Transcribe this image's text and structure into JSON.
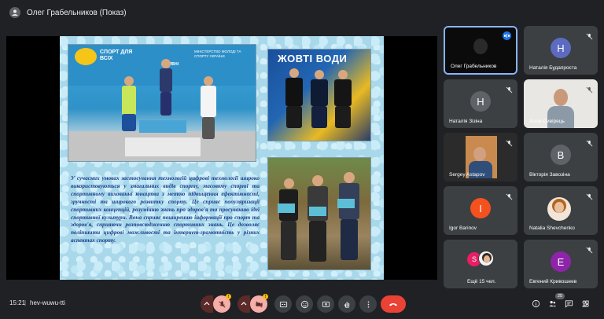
{
  "header": {
    "title": "Олег Грабельников (Показ)"
  },
  "slide": {
    "photo1_banner_left": "СПОРТ ДЛЯ ВСІХ",
    "photo1_banner_mid": "АКТИВНІ",
    "photo1_banner_right": "МІНІСТЕРСТВО МОЛОДІ ТА СПОРТУ УКРАЇНИ",
    "photo2_banner": "ЖОВТІ ВОДИ",
    "text": "У сучасних умовах застосування технологій цифрові технології широко використовуються у змагальних видів спорту, масовому спорті та спортивному вихованні юнацтва з метою підвищення ефективності, зручності та широкого розвитку спорту. Це сприяє популяризації спортивних концепцій, розумінню знань про здоров'я та просуванню ідеї спортивної культури. Вона сприяє поширенню інформації про спорт та здоров'я, сприяючи розповсюдженню спортивних знань. Це дозволяє поліпшити цифрові можливості та інтернет-грамотність у різних аспектах спорту."
  },
  "participants": [
    {
      "name": "Олег Грабельников",
      "type": "video",
      "speaking": true
    },
    {
      "name": "Наталія Будапроста",
      "type": "avatar",
      "initial": "Н",
      "color": "#5c6bc0"
    },
    {
      "name": "Наталія Зізіна",
      "type": "avatar",
      "initial": "Н",
      "color": "#5f6368"
    },
    {
      "name": "Алла Сивірець",
      "type": "video"
    },
    {
      "name": "Sergey Astapov",
      "type": "video"
    },
    {
      "name": "Вікторія Завозіна",
      "type": "avatar",
      "initial": "В",
      "color": "#5f6368"
    },
    {
      "name": "Igor Barinov",
      "type": "avatar",
      "initial": "I",
      "color": "#f4511e"
    },
    {
      "name": "Natalia Shevchenko",
      "type": "video"
    },
    {
      "name": "Ещё 15 чел.",
      "type": "more",
      "initial": "S"
    },
    {
      "name": "Евгений Кривошеев",
      "type": "avatar",
      "initial": "Е",
      "color": "#8e24aa"
    }
  ],
  "bottom": {
    "time": "15:21",
    "separator": "|",
    "meeting_code": "hev-wuwu-tti",
    "participant_count": "25"
  }
}
